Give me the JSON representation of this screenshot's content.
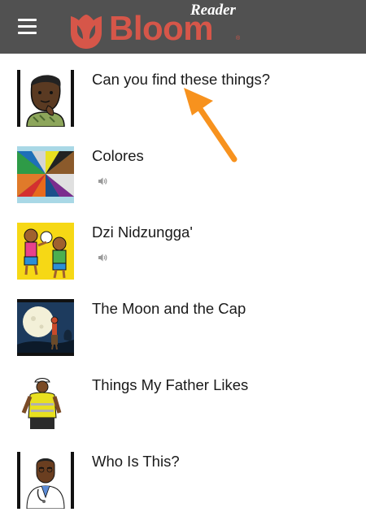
{
  "header": {
    "menu_icon": "hamburger-menu-icon",
    "logo": {
      "word": "Bloom",
      "subtitle": "Reader",
      "registered_mark": "®",
      "colors": {
        "brand": "#d65649",
        "subtitle": "#ffffff"
      }
    },
    "background_color": "#515151"
  },
  "books": [
    {
      "title": "Can you find these things?",
      "has_audio": false,
      "thumbnail": "thinking-man-portrait"
    },
    {
      "title": "Colores",
      "has_audio": true,
      "thumbnail": "color-wheel-segments"
    },
    {
      "title": "Dzi Nidzungga'",
      "has_audio": true,
      "thumbnail": "children-playing-on-yellow"
    },
    {
      "title": "The Moon and the Cap",
      "has_audio": false,
      "thumbnail": "night-moon-scene"
    },
    {
      "title": "Things My Father Likes",
      "has_audio": false,
      "thumbnail": "worker-in-safety-vest"
    },
    {
      "title": "Who Is This?",
      "has_audio": false,
      "thumbnail": "doctor-portrait"
    }
  ],
  "annotation": {
    "icon": "pointer-arrow-icon",
    "color": "#f7921e"
  }
}
